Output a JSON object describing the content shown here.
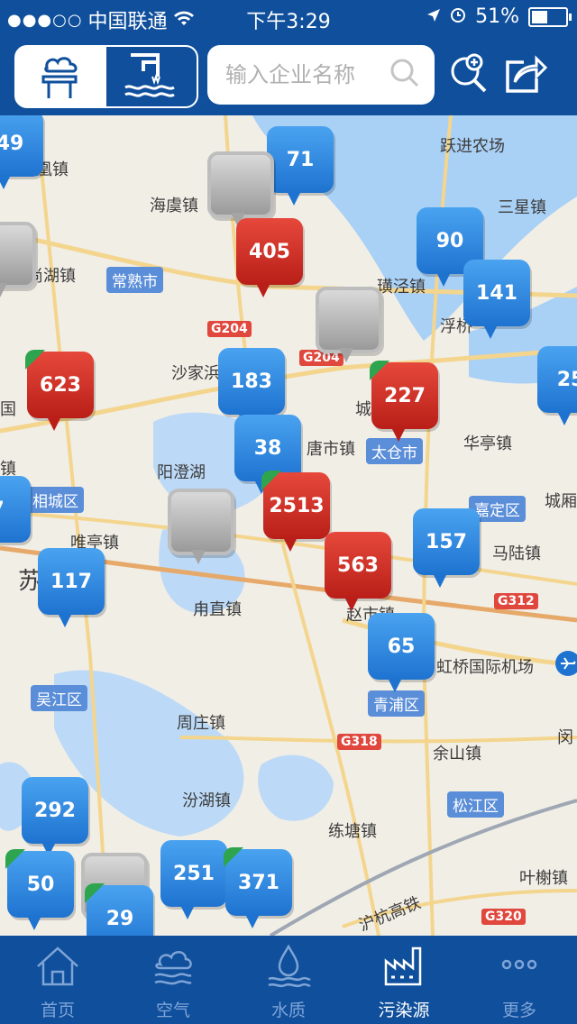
{
  "status_bar": {
    "signal": "●●●○○",
    "carrier": "中国联通",
    "time": "下午3:29",
    "battery": "51%",
    "battery_level": 0.51
  },
  "toolbar": {
    "segments": [
      {
        "icon": "air-chimney-icon",
        "active": false
      },
      {
        "icon": "water-outlet-icon",
        "active": true
      }
    ],
    "search_placeholder": "输入企业名称",
    "zoom_icon": "zoom-in-icon",
    "share_icon": "share-icon"
  },
  "map": {
    "places": [
      "凰镇",
      "海虞镇",
      "跃进农场",
      "三星镇",
      "尚湖镇",
      "常熟市",
      "璜泾镇",
      "浮桥",
      "沙家浜",
      "城",
      "太仓市",
      "华亭镇",
      "阳澄湖",
      "唐市镇",
      "城厢",
      "嘉定区",
      "马陆镇",
      "唯亭镇",
      "苏",
      "甪直镇",
      "赵市镇",
      "虹桥国际机场",
      "吴江区",
      "青浦区",
      "周庄镇",
      "余山镇",
      "松江区",
      "汾湖镇",
      "练塘镇",
      "叶榭镇",
      "沪杭高铁",
      "国",
      "镇",
      "相城区",
      "闵"
    ],
    "roads": [
      "G204",
      "G204",
      "G312",
      "G318",
      "G320"
    ],
    "markers": [
      {
        "value": "49",
        "color": "blue"
      },
      {
        "value": "71",
        "color": "blue"
      },
      {
        "value": "",
        "color": "gray"
      },
      {
        "value": "90",
        "color": "blue"
      },
      {
        "value": "405",
        "color": "red"
      },
      {
        "value": "141",
        "color": "blue"
      },
      {
        "value": "",
        "color": "gray"
      },
      {
        "value": "",
        "color": "gray"
      },
      {
        "value": "623",
        "color": "red"
      },
      {
        "value": "183",
        "color": "blue"
      },
      {
        "value": "227",
        "color": "red"
      },
      {
        "value": "25",
        "color": "blue"
      },
      {
        "value": "38",
        "color": "blue"
      },
      {
        "value": "2513",
        "color": "red"
      },
      {
        "value": "",
        "color": "gray"
      },
      {
        "value": "157",
        "color": "blue"
      },
      {
        "value": "7",
        "color": "blue"
      },
      {
        "value": "563",
        "color": "red"
      },
      {
        "value": "117",
        "color": "blue"
      },
      {
        "value": "65",
        "color": "blue"
      },
      {
        "value": "292",
        "color": "blue"
      },
      {
        "value": "50",
        "color": "blue"
      },
      {
        "value": "",
        "color": "gray"
      },
      {
        "value": "251",
        "color": "blue"
      },
      {
        "value": "371",
        "color": "blue"
      },
      {
        "value": "29",
        "color": "blue"
      }
    ]
  },
  "tabs": [
    {
      "label": "首页",
      "icon": "home-icon",
      "active": false
    },
    {
      "label": "空气",
      "icon": "air-icon",
      "active": false
    },
    {
      "label": "水质",
      "icon": "water-quality-icon",
      "active": false
    },
    {
      "label": "污染源",
      "icon": "factory-icon",
      "active": true
    },
    {
      "label": "更多",
      "icon": "more-icon",
      "active": false
    }
  ],
  "colors": {
    "brand": "#0f4f9c",
    "marker_blue": "#1e73d0",
    "marker_red": "#b91f18",
    "marker_gray": "#a4a4a4",
    "flag_green": "#2ea44f"
  }
}
